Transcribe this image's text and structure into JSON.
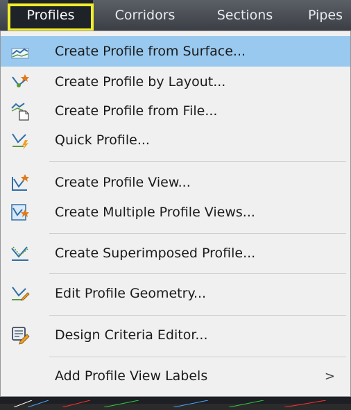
{
  "menubar": {
    "items": [
      {
        "label": "Profiles"
      },
      {
        "label": "Corridors"
      },
      {
        "label": "Sections"
      },
      {
        "label": "Pipes"
      }
    ]
  },
  "dropdown": {
    "items": [
      {
        "label": "Create Profile from Surface...",
        "icon": "profile-from-surface-icon"
      },
      {
        "label": "Create Profile by Layout...",
        "icon": "profile-layout-icon"
      },
      {
        "label": "Create Profile from File...",
        "icon": "profile-from-file-icon"
      },
      {
        "label": "Quick Profile...",
        "icon": "quick-profile-icon"
      },
      {
        "label": "Create Profile View...",
        "icon": "profile-view-icon"
      },
      {
        "label": "Create Multiple Profile Views...",
        "icon": "multiple-profile-views-icon"
      },
      {
        "label": "Create Superimposed Profile...",
        "icon": "superimposed-profile-icon"
      },
      {
        "label": "Edit Profile Geometry...",
        "icon": "edit-profile-geometry-icon"
      },
      {
        "label": "Design Criteria Editor...",
        "icon": "design-criteria-editor-icon"
      },
      {
        "label": "Add Profile View Labels",
        "submenu_arrow": ">"
      }
    ]
  },
  "colors": {
    "highlight": "#99c9ef",
    "annotation_yellow": "#f4ee2a",
    "menubar": "#4a4e55",
    "menu_background": "#f0f0f0"
  }
}
